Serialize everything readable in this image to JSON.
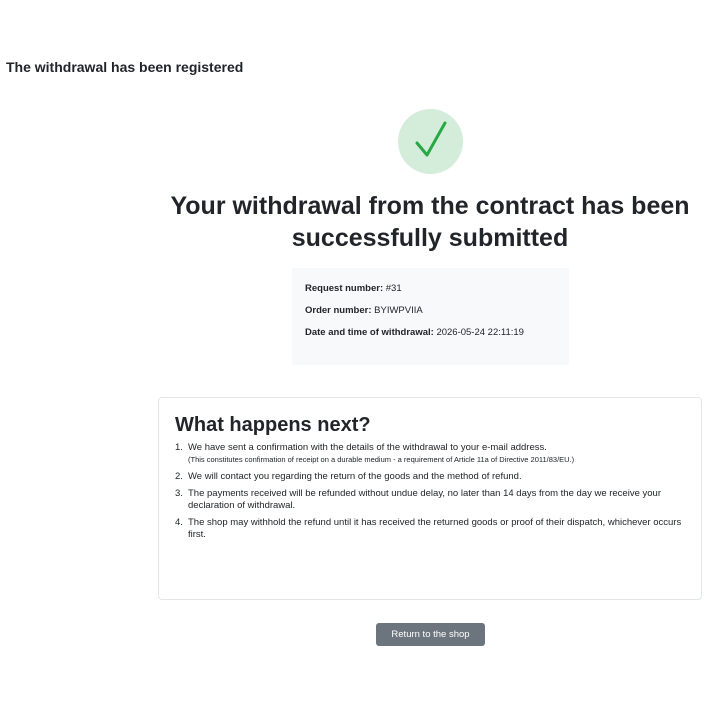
{
  "page": {
    "heading": "The withdrawal has been registered"
  },
  "confirmation": {
    "icon": "check-icon",
    "title": "Your withdrawal from the contract has been successfully submitted",
    "colors": {
      "icon_background": "#d4edda",
      "icon_check": "#28a745"
    }
  },
  "details": {
    "request_number_label": "Request number:",
    "request_number_value": "#31",
    "order_number_label": "Order number:",
    "order_number_value": "BYIWPVIIA",
    "datetime_label": "Date and time of withdrawal:",
    "datetime_value": "2026-05-24 22:11:19"
  },
  "next_steps": {
    "title": "What happens next?",
    "items": [
      {
        "number": "1.",
        "text": "We have sent a confirmation with the details of the withdrawal to your e-mail address.",
        "note": "(This constitutes confirmation of receipt on a durable medium - a requirement of Article 11a of Directive 2011/83/EU.)"
      },
      {
        "number": "2.",
        "text": "We will contact you regarding the return of the goods and the method of refund."
      },
      {
        "number": "3.",
        "text": "The payments received will be refunded without undue delay, no later than 14 days from the day we receive your declaration of withdrawal."
      },
      {
        "number": "4.",
        "text": "The shop may withhold the refund until it has received the returned goods or proof of their dispatch, whichever occurs first."
      }
    ]
  },
  "actions": {
    "return_label": "Return to the shop",
    "return_color": "#6c757d"
  }
}
